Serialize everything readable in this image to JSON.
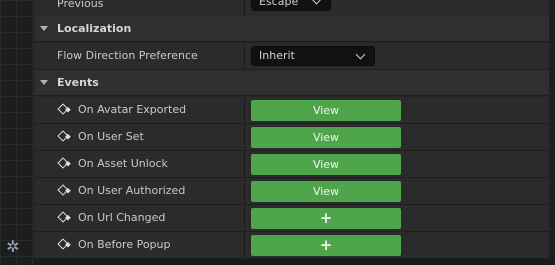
{
  "rows_top": {
    "previous_label": "Previous",
    "previous_value": "Escape"
  },
  "categories": {
    "localization": "Localization",
    "events": "Events"
  },
  "localization": {
    "flow_label": "Flow Direction Preference",
    "flow_value": "Inherit"
  },
  "events": {
    "items": [
      {
        "label": "On Avatar Exported",
        "button": "View"
      },
      {
        "label": "On User Set",
        "button": "View"
      },
      {
        "label": "On Asset Unlock",
        "button": "View"
      },
      {
        "label": "On User Authorized",
        "button": "View"
      },
      {
        "label": "On Url Changed",
        "button": "+"
      },
      {
        "label": "On Before Popup",
        "button": "+"
      }
    ]
  },
  "icons": {
    "settings": "gear-icon",
    "event": "event-pin-icon",
    "collapse": "chevron-down-icon"
  },
  "colors": {
    "accent_green": "#4ea54a",
    "panel_bg": "#2b2b2b"
  }
}
